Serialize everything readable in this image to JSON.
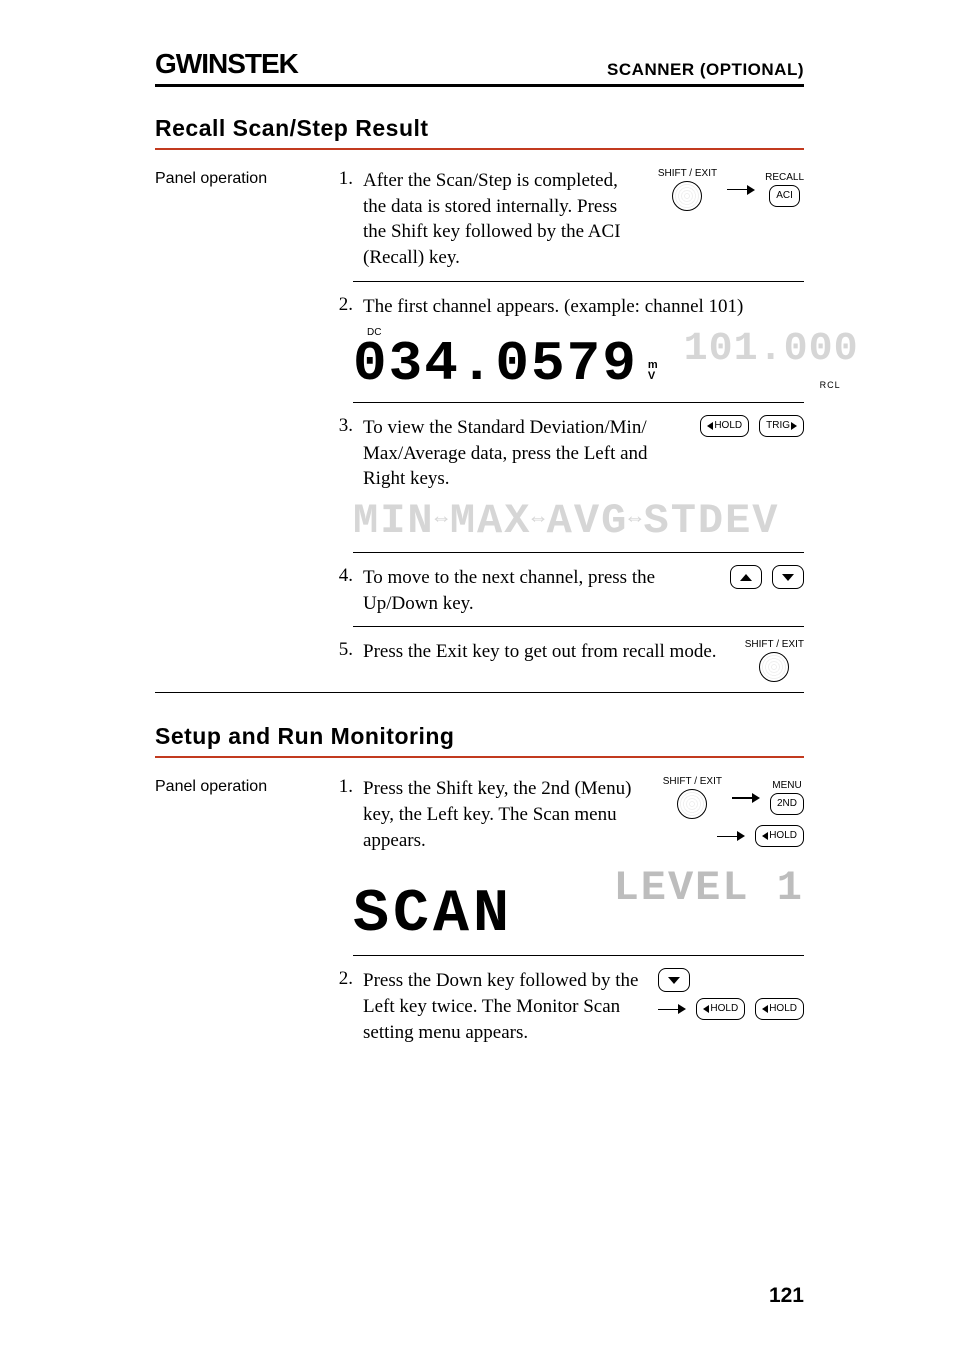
{
  "header": {
    "brand": "GWINSTEK",
    "right": "SCANNER (OPTIONAL)"
  },
  "section1": {
    "title": "Recall Scan/Step Result",
    "left_label": "Panel operation",
    "steps": [
      {
        "n": "1.",
        "text": "After the Scan/Step is completed, the data is stored internally. Press the Shift key followed by the ACI (Recall) key."
      },
      {
        "n": "2.",
        "text": "The first channel appears. (example: channel 101)"
      },
      {
        "n": "3.",
        "text": "To view the Standard Deviation/Min/ Max/Average data, press the Left and Right keys."
      },
      {
        "n": "4.",
        "text": "To move to the next channel, press the Up/Down key."
      },
      {
        "n": "5.",
        "text": "Press the Exit key to get out from recall mode."
      }
    ],
    "lcd": {
      "dc": "DC",
      "reading": "034.0579",
      "units": "m   V",
      "side": "101.000",
      "rcl": "RCL",
      "dimrow": "MIN⇔MAX⇔AVG⇔STDEV"
    },
    "icons": {
      "shift_exit": "SHIFT / EXIT",
      "recall": "RECALL",
      "aci": "ACI",
      "hold": "HOLD",
      "trig": "TRIG"
    }
  },
  "section2": {
    "title": "Setup and Run Monitoring",
    "left_label": "Panel operation",
    "steps": [
      {
        "n": "1.",
        "text": "Press the Shift key, the 2nd (Menu) key, the Left key. The Scan menu appears."
      },
      {
        "n": "2.",
        "text": "Press the Down key followed by the Left key twice. The Monitor Scan setting menu appears."
      }
    ],
    "lcd": {
      "scan": "SCAN",
      "level": "LEVEL 1"
    },
    "icons": {
      "shift_exit": "SHIFT / EXIT",
      "menu": "MENU",
      "second": "2ND",
      "hold": "HOLD"
    }
  },
  "page_number": "121"
}
